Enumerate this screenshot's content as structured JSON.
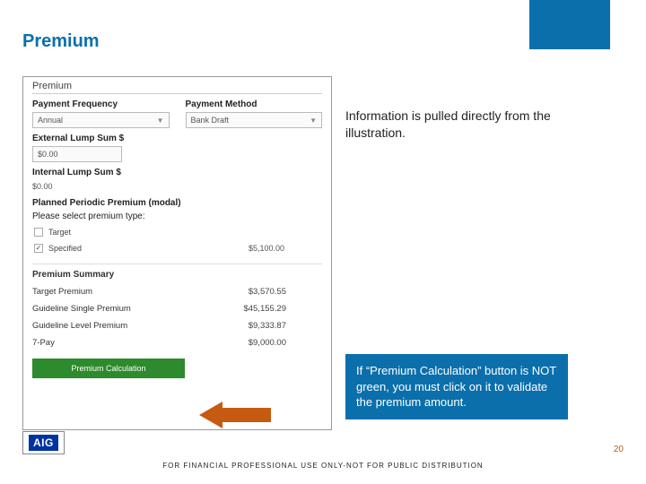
{
  "slide": {
    "title": "Premium",
    "page_number": "20",
    "footer": "FOR FINANCIAL PROFESSIONAL USE ONLY-NOT FOR PUBLIC DISTRIBUTION"
  },
  "logo": {
    "text": "AIG"
  },
  "notes": {
    "info": "Information is pulled directly from the illustration.",
    "validate": "If “Premium Calculation” button is NOT green, you must click on it to validate the premium amount."
  },
  "panel": {
    "title": "Premium",
    "payment_frequency": {
      "label": "Payment Frequency",
      "value": "Annual"
    },
    "payment_method": {
      "label": "Payment Method",
      "value": "Bank Draft"
    },
    "external_lump": {
      "label": "External Lump Sum $",
      "value": "$0.00"
    },
    "internal_lump": {
      "label": "Internal Lump Sum $",
      "value": "$0.00"
    },
    "planned_label": "Planned Periodic Premium (modal)",
    "select_prompt": "Please select premium type:",
    "target": {
      "label": "Target",
      "checked": false
    },
    "specified": {
      "label": "Specified",
      "checked": true,
      "amount": "$5,100.00"
    },
    "summary_header": "Premium Summary",
    "rows": {
      "target_premium": {
        "label": "Target Premium",
        "value": "$3,570.55"
      },
      "guideline_single": {
        "label": "Guideline Single Premium",
        "value": "$45,155.29"
      },
      "guideline_level": {
        "label": "Guideline Level Premium",
        "value": "$9,333.87"
      },
      "seven_pay": {
        "label": "7-Pay",
        "value": "$9,000.00"
      }
    },
    "button": "Premium Calculation"
  }
}
